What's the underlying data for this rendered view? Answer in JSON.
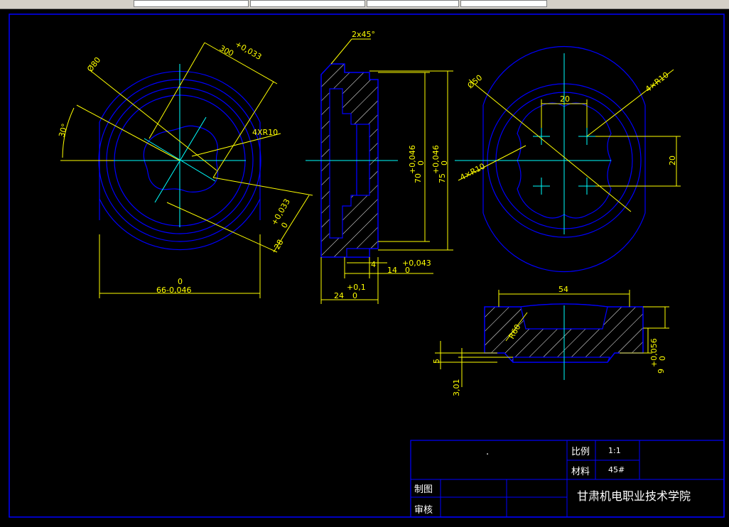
{
  "toolbar": {
    "fields": [
      "",
      "",
      "",
      ""
    ]
  },
  "dimensions": {
    "d80": "Ø80",
    "d30": "30",
    "d30_tol_u": "+0,033",
    "d30_tol_l": "0",
    "angle30": "30°",
    "r10_left": "4XR10",
    "d28": "28",
    "d28_tol_u": "+0,033",
    "d28_tol_l": "0",
    "d66_top": "0",
    "d66": "66-0,046",
    "chamfer": "2x45°",
    "d70": "70",
    "d70_tol_u": "+0,046",
    "d70_tol_l": "0",
    "d75": "75",
    "d75_tol_u": "+0,046",
    "d75_tol_l": "0",
    "d4": "4",
    "d14": "14",
    "d14_tol_u": "+0,043",
    "d14_tol_l": "0",
    "d24": "24",
    "d24_tol_u": "+0,1",
    "d24_tol_l": "0",
    "d50": "Ø50",
    "r10_right_top": "4×R10",
    "r10_right_left": "4×R10",
    "d20_top": "20",
    "d20_right": "20",
    "d54": "54",
    "r60": "R60",
    "d9": "9",
    "d9_tol_u": "+0,056",
    "d9_tol_l": "0",
    "d5": "5",
    "d3": "3,01"
  },
  "title_block": {
    "scale_label": "比例",
    "scale_value": "1:1",
    "material_label": "材料",
    "material_value": "45#",
    "drawn_label": "制图",
    "checked_label": "审核",
    "school": "甘肃机电职业技术学院",
    "part_name": "."
  },
  "colors": {
    "background": "#000000",
    "outline": "#0000ff",
    "center": "#00ffff",
    "dimension": "#ffff00",
    "hatch": "#ffffff",
    "frame": "#0000ff",
    "text": "#ffffff"
  }
}
